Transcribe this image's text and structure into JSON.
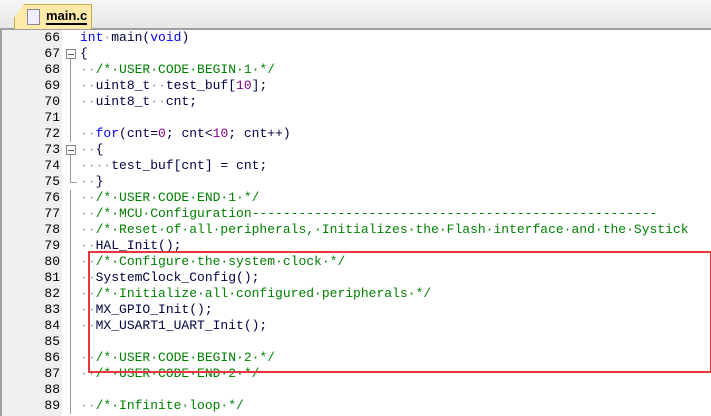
{
  "tab": {
    "label": "main.c"
  },
  "colors": {
    "keyword": "#0000ff",
    "comment": "#008000",
    "number": "#800080",
    "highlight": "#e8383d"
  },
  "lines": [
    {
      "num": "66",
      "fold": "",
      "segs": [
        [
          "kw",
          "int"
        ],
        [
          "ws",
          "·"
        ],
        [
          "tx",
          "main("
        ],
        [
          "kw",
          "void"
        ],
        [
          "tx",
          ")"
        ]
      ]
    },
    {
      "num": "67",
      "fold": "box",
      "segs": [
        [
          "tx",
          "{"
        ]
      ]
    },
    {
      "num": "68",
      "fold": "line",
      "segs": [
        [
          "ws",
          "··"
        ],
        [
          "cm",
          "/*·USER·CODE·BEGIN·1·*/"
        ]
      ]
    },
    {
      "num": "69",
      "fold": "line",
      "segs": [
        [
          "ws",
          "··"
        ],
        [
          "tx",
          "uint8_t"
        ],
        [
          "ws",
          "··"
        ],
        [
          "tx",
          "test_buf["
        ],
        [
          "nm",
          "10"
        ],
        [
          "tx",
          "];"
        ]
      ]
    },
    {
      "num": "70",
      "fold": "line",
      "segs": [
        [
          "ws",
          "··"
        ],
        [
          "tx",
          "uint8_t"
        ],
        [
          "ws",
          "··"
        ],
        [
          "tx",
          "cnt;"
        ]
      ]
    },
    {
      "num": "71",
      "fold": "line",
      "segs": []
    },
    {
      "num": "72",
      "fold": "line",
      "segs": [
        [
          "ws",
          "··"
        ],
        [
          "kw",
          "for"
        ],
        [
          "tx",
          "(cnt="
        ],
        [
          "nm",
          "0"
        ],
        [
          "tx",
          "; cnt<"
        ],
        [
          "nm",
          "10"
        ],
        [
          "tx",
          "; cnt++)"
        ]
      ]
    },
    {
      "num": "73",
      "fold": "box",
      "segs": [
        [
          "ws",
          "··"
        ],
        [
          "tx",
          "{"
        ]
      ]
    },
    {
      "num": "74",
      "fold": "line",
      "segs": [
        [
          "ws",
          "····"
        ],
        [
          "tx",
          "test_buf[cnt] = cnt;"
        ]
      ]
    },
    {
      "num": "75",
      "fold": "corner",
      "segs": [
        [
          "ws",
          "··"
        ],
        [
          "tx",
          "}"
        ]
      ]
    },
    {
      "num": "76",
      "fold": "line",
      "segs": [
        [
          "ws",
          "··"
        ],
        [
          "cm",
          "/*·USER·CODE·END·1·*/"
        ]
      ]
    },
    {
      "num": "77",
      "fold": "line",
      "segs": [
        [
          "ws",
          "··"
        ],
        [
          "cm",
          "/*·MCU·Configuration----------------------------------------------------"
        ]
      ]
    },
    {
      "num": "78",
      "fold": "line",
      "segs": [
        [
          "ws",
          "··"
        ],
        [
          "cm",
          "/*·Reset·of·all·peripherals,·Initializes·the·Flash·interface·and·the·Systick"
        ]
      ]
    },
    {
      "num": "79",
      "fold": "line",
      "segs": [
        [
          "ws",
          "··"
        ],
        [
          "tx",
          "HAL_Init();"
        ]
      ]
    },
    {
      "num": "80",
      "fold": "line",
      "segs": [
        [
          "ws",
          "··"
        ],
        [
          "cm",
          "/*·Configure·the·system·clock·*/"
        ]
      ]
    },
    {
      "num": "81",
      "fold": "line",
      "segs": [
        [
          "ws",
          "··"
        ],
        [
          "tx",
          "SystemClock_Config();"
        ]
      ]
    },
    {
      "num": "82",
      "fold": "line",
      "segs": [
        [
          "ws",
          "··"
        ],
        [
          "cm",
          "/*·Initialize·all·configured·peripherals·*/"
        ]
      ]
    },
    {
      "num": "83",
      "fold": "line",
      "segs": [
        [
          "ws",
          "··"
        ],
        [
          "tx",
          "MX_GPIO_Init();"
        ]
      ]
    },
    {
      "num": "84",
      "fold": "line",
      "segs": [
        [
          "ws",
          "··"
        ],
        [
          "tx",
          "MX_USART1_UART_Init();"
        ]
      ]
    },
    {
      "num": "85",
      "fold": "line",
      "segs": []
    },
    {
      "num": "86",
      "fold": "line",
      "segs": [
        [
          "ws",
          "··"
        ],
        [
          "cm",
          "/*·USER·CODE·BEGIN·2·*/"
        ]
      ]
    },
    {
      "num": "87",
      "fold": "line",
      "segs": [
        [
          "ws",
          "··"
        ],
        [
          "cm",
          "/*·USER·CODE·END·2·*/"
        ]
      ]
    },
    {
      "num": "88",
      "fold": "line",
      "segs": []
    },
    {
      "num": "89",
      "fold": "line",
      "segs": [
        [
          "ws",
          "··"
        ],
        [
          "cm",
          "/*·Infinite·loop·*/"
        ]
      ]
    }
  ]
}
